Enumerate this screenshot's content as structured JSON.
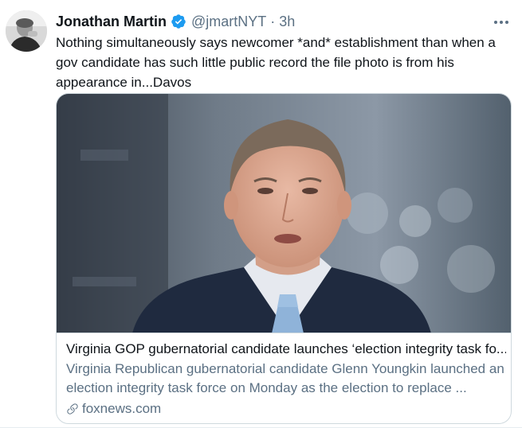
{
  "tweet": {
    "author_name": "Jonathan Martin",
    "handle": "@jmartNYT",
    "separator": "·",
    "time": "3h",
    "text": "Nothing simultaneously says newcomer *and* establishment than when a gov candidate has such little public record the file photo is from his appearance in...Davos"
  },
  "card": {
    "title": "Virginia GOP gubernatorial candidate launches ‘election integrity task fo...",
    "description": "Virginia Republican gubernatorial candidate Glenn Youngkin launched an election integrity task force on Monday as the election to replace ...",
    "domain": "foxnews.com"
  },
  "colors": {
    "verified": "#1d9bf0",
    "secondary_text": "#5b7083",
    "border": "#cfd9de"
  },
  "icons": [
    "verified-badge-icon",
    "more-options-icon",
    "link-icon"
  ]
}
